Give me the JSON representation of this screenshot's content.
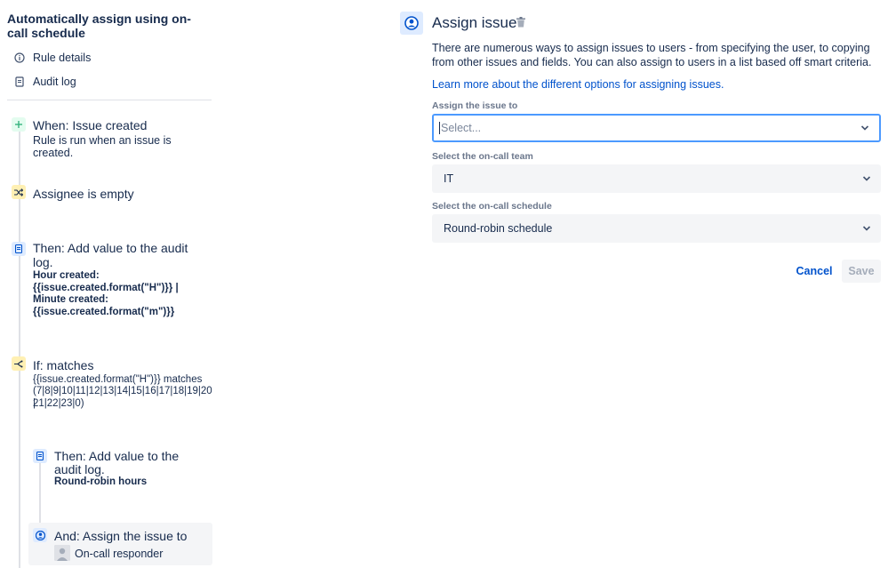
{
  "rule": {
    "title": "Automatically assign using on-call schedule",
    "nav": [
      {
        "label": "Rule details",
        "icon": "info-icon"
      },
      {
        "label": "Audit log",
        "icon": "document-icon"
      }
    ]
  },
  "components": {
    "trigger": {
      "title": "When: Issue created",
      "sub": "Rule is run when an issue is created.",
      "icon": "plus-icon"
    },
    "condition": {
      "title": "Assignee is empty",
      "icon": "shuffle-icon"
    },
    "action_log": {
      "title_line1": "Then: Add value to the audit",
      "title_line2": "log.",
      "bold_lines": [
        "Hour created:",
        "{{issue.created.format(\"H\")}} |",
        "Minute created:",
        "{{issue.created.format(\"m\")}}"
      ],
      "icon": "document-icon"
    },
    "if_matches": {
      "title": "If: matches",
      "lines": [
        "{{issue.created.format(\"H\")}} matches",
        "(7|8|9|10|11|12|13|14|15|16|17|18|19|20|",
        "21|22|23|0)"
      ],
      "icon": "branch-icon"
    },
    "nested_log": {
      "title_line1": "Then: Add value to the",
      "title_line2": "audit log.",
      "bold": "Round-robin hours",
      "icon": "document-icon"
    },
    "assign": {
      "title": "And: Assign the issue to",
      "value": "On-call responder",
      "icon": "user-circle-icon"
    }
  },
  "panel": {
    "title": "Assign issue",
    "description": "There are numerous ways to assign issues to users - from specifying the user, to copying from other issues and fields. You can also assign to users in a list based off smart criteria.",
    "learn_more": "Learn more about the different options for assigning issues.",
    "fields": {
      "assign_to": {
        "label": "Assign the issue to",
        "placeholder": "Select..."
      },
      "team": {
        "label": "Select the on-call team",
        "value": "IT"
      },
      "schedule": {
        "label": "Select the on-call schedule",
        "value": "Round-robin schedule"
      }
    },
    "cancel": "Cancel",
    "save": "Save"
  },
  "colors": {
    "link": "#0052cc",
    "focus": "#4c9aff",
    "condition_badge": "#fff0b3",
    "action_badge": "#deebff",
    "trigger_badge": "#e3fcef"
  }
}
